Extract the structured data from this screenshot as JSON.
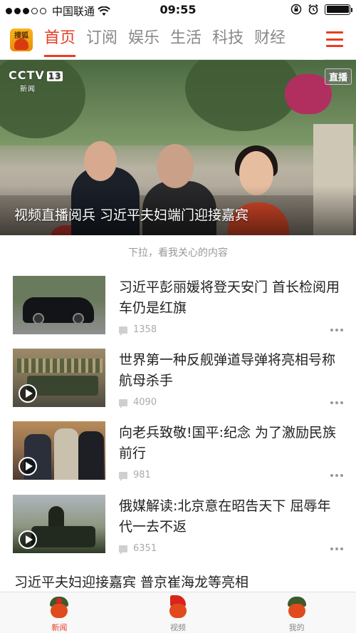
{
  "status_bar": {
    "carrier": "中国联通",
    "time": "09:55"
  },
  "nav": {
    "logo_text": "搜狐",
    "tabs": [
      {
        "label": "首页",
        "active": true
      },
      {
        "label": "订阅"
      },
      {
        "label": "娱乐"
      },
      {
        "label": "生活"
      },
      {
        "label": "科技"
      },
      {
        "label": "财经"
      }
    ],
    "accent": "#e83d23"
  },
  "hero": {
    "channel": "CCTV",
    "channel_num": "13",
    "channel_sub": "新闻",
    "badge": "直播",
    "title": "视频直播阅兵  习近平夫妇端门迎接嘉宾"
  },
  "feed": {
    "pull_hint": "下拉，看我关心的内容",
    "items": [
      {
        "title": "习近平彭丽媛将登天安门 首长检阅用车仍是红旗",
        "comments": "1358",
        "video": false
      },
      {
        "title": "世界第一种反舰弹道导弹将亮相号称航母杀手",
        "comments": "4090",
        "video": true
      },
      {
        "title": "向老兵致敬!国平:纪念 为了激励民族前行",
        "comments": "981",
        "video": true
      },
      {
        "title": "俄媒解读:北京意在昭告天下 屈辱年代一去不返",
        "comments": "6351",
        "video": true
      }
    ],
    "partial_title": "习近平夫妇迎接嘉宾  普京崔海龙等亮相"
  },
  "tabbar": {
    "items": [
      {
        "label": "新闻",
        "active": true
      },
      {
        "label": "视频"
      },
      {
        "label": "我的"
      }
    ]
  }
}
